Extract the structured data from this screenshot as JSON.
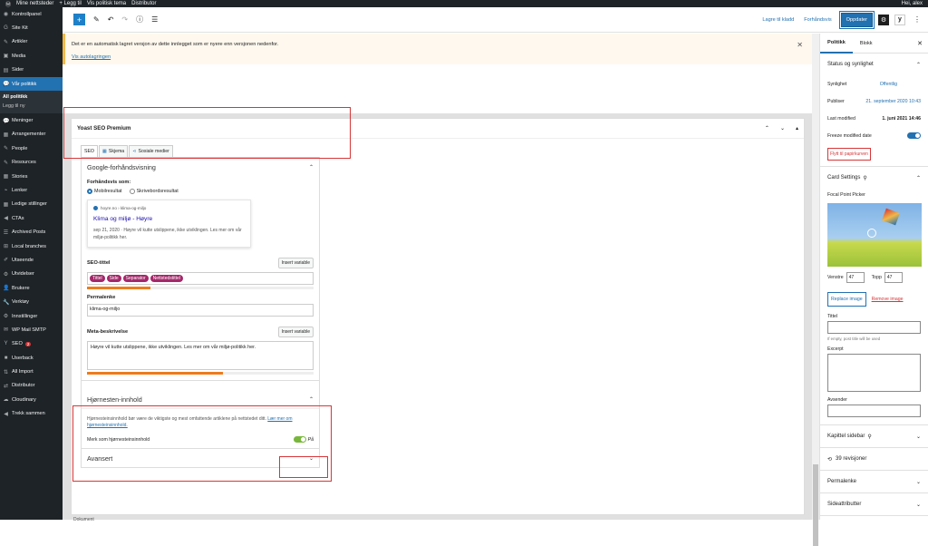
{
  "adminbar": {
    "site": "Mine nettsteder",
    "new": "+ Legg til",
    "view": "Vis politisk tema",
    "distributor": "Distributor",
    "greeting": "Hei, alex"
  },
  "sidebar": {
    "items": [
      {
        "icon": "dashboard-icon",
        "glyph": "◉",
        "label": "Kontrollpanel"
      },
      {
        "icon": "sitekit-icon",
        "glyph": "G",
        "label": "Site Kit"
      },
      {
        "icon": "pin-icon",
        "glyph": "✎",
        "label": "Artikler"
      },
      {
        "icon": "media-icon",
        "glyph": "▣",
        "label": "Media"
      },
      {
        "icon": "pages-icon",
        "glyph": "▤",
        "label": "Sider"
      },
      {
        "icon": "comment-icon",
        "glyph": "💬",
        "label": "Vår politikk",
        "active": true
      },
      {
        "icon": "comment-icon",
        "glyph": "💬",
        "label": "Meninger"
      },
      {
        "icon": "calendar-icon",
        "glyph": "▦",
        "label": "Arrangementer"
      },
      {
        "icon": "pin-icon",
        "glyph": "✎",
        "label": "People"
      },
      {
        "icon": "pin-icon",
        "glyph": "✎",
        "label": "Resources"
      },
      {
        "icon": "grid-icon",
        "glyph": "▦",
        "label": "Stories"
      },
      {
        "icon": "link-icon",
        "glyph": "⌁",
        "label": "Lenker"
      },
      {
        "icon": "grid-icon",
        "glyph": "▦",
        "label": "Ledige stillinger"
      },
      {
        "icon": "megaphone-icon",
        "glyph": "◀",
        "label": "CTAs"
      },
      {
        "icon": "list-icon",
        "glyph": "☰",
        "label": "Archived Posts"
      },
      {
        "icon": "network-icon",
        "glyph": "⊞",
        "label": "Local branches"
      },
      {
        "icon": "brush-icon",
        "glyph": "✐",
        "label": "Utseende"
      },
      {
        "icon": "plugin-icon",
        "glyph": "⚙",
        "label": "Utvidelser"
      },
      {
        "icon": "users-icon",
        "glyph": "👤",
        "label": "Brukere"
      },
      {
        "icon": "wrench-icon",
        "glyph": "🔧",
        "label": "Verktøy"
      },
      {
        "icon": "settings-icon",
        "glyph": "⚙",
        "label": "Innstillinger"
      },
      {
        "icon": "mail-icon",
        "glyph": "✉",
        "label": "WP Mail SMTP"
      },
      {
        "icon": "yoast-icon",
        "glyph": "Y",
        "label": "SEO",
        "badge": "2"
      },
      {
        "icon": "userback-icon",
        "glyph": "■",
        "label": "Userback"
      },
      {
        "icon": "import-icon",
        "glyph": "⇅",
        "label": "All Import"
      },
      {
        "icon": "distributor-icon",
        "glyph": "⇄",
        "label": "Distributor"
      },
      {
        "icon": "cloud-icon",
        "glyph": "☁",
        "label": "Cloudinary"
      },
      {
        "icon": "collapse-icon",
        "glyph": "◀",
        "label": "Trekk sammen"
      }
    ],
    "submenu": [
      "All politikk",
      "Legg til ny"
    ]
  },
  "toolbar": {
    "draft": "Lagre til kladd",
    "preview": "Forhåndsvis",
    "update": "Oppdater"
  },
  "notice": {
    "text": "Det er en automatisk lagret versjon av dette innlegget som er nyere enn versjonen nedenfor.",
    "link": "Vis autolagringen"
  },
  "yoast": {
    "title": "Yoast SEO Premium",
    "tabs": [
      "SEO",
      "Skjema",
      "Sosiale medier"
    ],
    "google_heading": "Google-forhåndsvisning",
    "preview_as": "Forhåndsvis som:",
    "mobile": "Mobilresultat",
    "desktop": "Skrivebordsresultat",
    "snippet_url": "hoyre.no › klima-og-miljo",
    "snippet_title": "Klima og miljø - Høyre",
    "snippet_desc": "sep 21, 2020 · Høyre vil kutte utslippene, ikke utviklingen. Les mer om vår miljø-politikk her.",
    "seo_title_label": "SEO-tittel",
    "insert_variable": "Insert variable",
    "pills": [
      "Tittel",
      "Side",
      "Separator",
      "Nettstedstittel"
    ],
    "seo_title_progress": 0.28,
    "permalink_label": "Permalenke",
    "permalink": "klima-og-miljo",
    "meta_label": "Meta-beskrivelse",
    "meta": "Høyre vil kutte utslippene, ikke utviklingen. Les mer om vår miljø-politikk her.",
    "meta_progress": 0.6,
    "cornerstone_heading": "Hjørnesten-innhold",
    "cornerstone_text": "Hjørnesteinsinnhold bør være de viktigste og mest omfattende artiklene på nettstedet ditt.",
    "cornerstone_link": "Lær mer om hjørnesteinsinnhold.",
    "cornerstone_toggle": "Merk som hjørnesteinsinnhold",
    "toggle_state": "På",
    "advanced": "Avansert"
  },
  "statusbar": "Dokument",
  "settings": {
    "tabs": [
      "Politikk",
      "Blokk"
    ],
    "status_heading": "Status og synlighet",
    "visibility_label": "Synlighet",
    "visibility": "Offentlig",
    "publish_label": "Publiser",
    "publish": "21. september 2020 10:43",
    "modified_label": "Last modified",
    "modified": "1. juni 2021 14:46",
    "freeze": "Freeze modified date",
    "trash": "Flytt til papirkurven",
    "card_heading": "Card Settings",
    "focal": "Focal Point Picker",
    "left_label": "Venstre",
    "left": "47",
    "top_label": "Topp",
    "top": "47",
    "replace": "Replace image",
    "remove": "Remove image",
    "title_label": "Tittel",
    "title_hint": "If empty, post title will be used",
    "excerpt_label": "Excerpt",
    "sender_label": "Avsender",
    "chapter": "Kapittel sidebar",
    "revisions": "39 revisjoner",
    "permalink": "Permalenke",
    "page_attrs": "Sideattributter"
  }
}
